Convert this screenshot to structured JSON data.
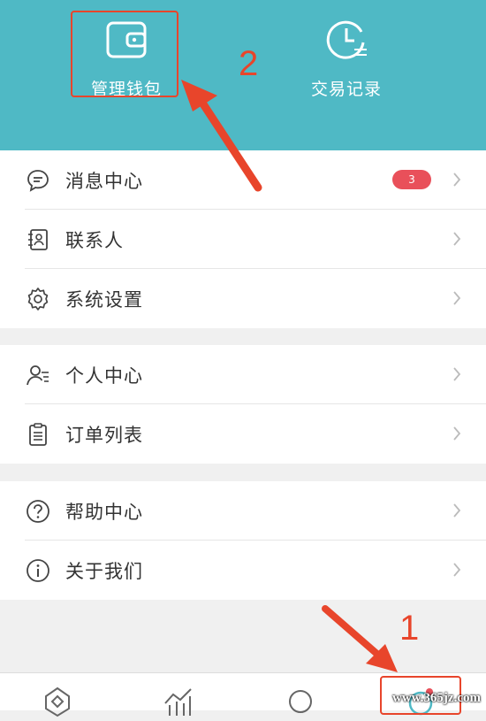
{
  "header": {
    "wallet_label": "管理钱包",
    "trade_label": "交易记录",
    "bg_color": "#4fb9c5"
  },
  "annotations": {
    "step1": "1",
    "step2": "2",
    "color": "#e8452b"
  },
  "menu_groups": [
    [
      {
        "label": "消息中心",
        "icon": "message-bubble-icon",
        "badge": "3"
      },
      {
        "label": "联系人",
        "icon": "contacts-icon"
      },
      {
        "label": "系统设置",
        "icon": "gear-icon"
      }
    ],
    [
      {
        "label": "个人中心",
        "icon": "person-icon"
      },
      {
        "label": "订单列表",
        "icon": "clipboard-icon"
      }
    ],
    [
      {
        "label": "帮助中心",
        "icon": "question-icon"
      },
      {
        "label": "关于我们",
        "icon": "info-icon"
      }
    ]
  ],
  "tabbar": {
    "tabs": [
      "diamond-tab-icon",
      "chart-tab-icon",
      "circle-tab-icon",
      "profile-tab-icon"
    ]
  },
  "watermark": "www.365jz.com"
}
